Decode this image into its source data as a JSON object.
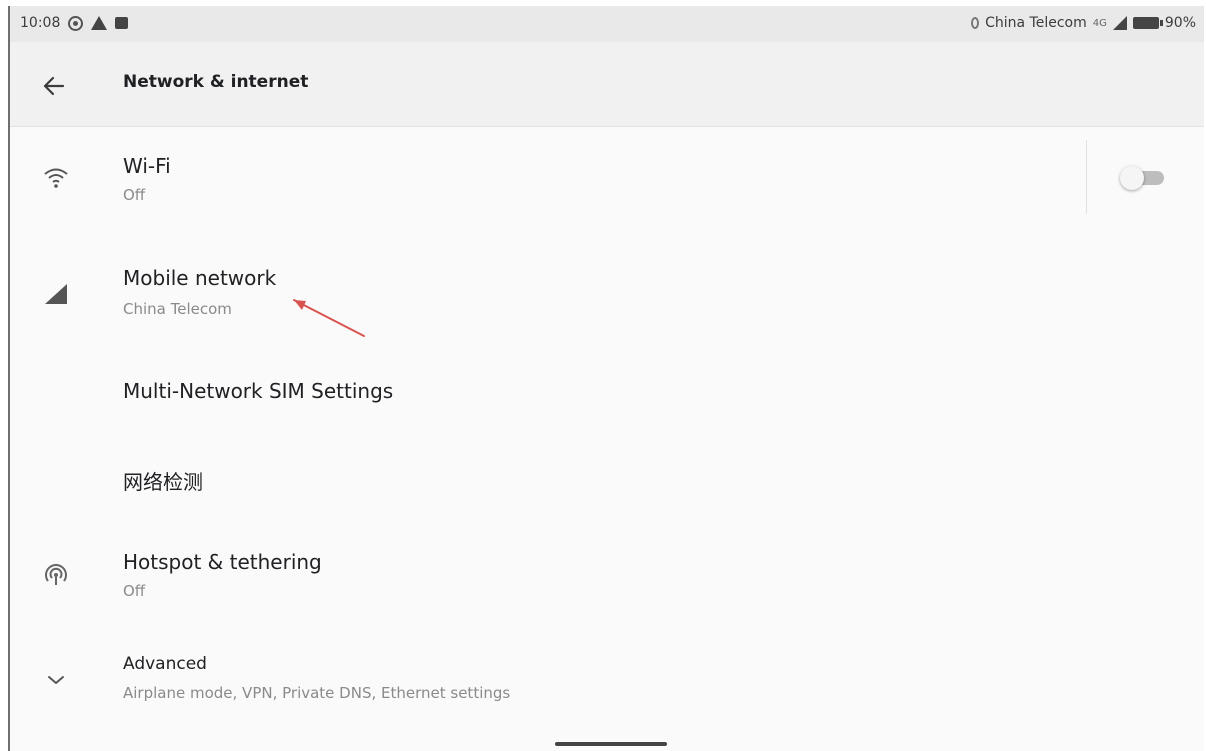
{
  "status_bar": {
    "time": "10:08",
    "carrier": "China Telecom",
    "network_type": "4G",
    "battery": "90%"
  },
  "app_bar": {
    "title": "Network & internet"
  },
  "items": [
    {
      "title": "Wi-Fi",
      "subtitle": "Off",
      "icon": "wifi-icon",
      "toggle_on": false
    },
    {
      "title": "Mobile network",
      "subtitle": "China Telecom",
      "icon": "signal-icon"
    },
    {
      "title": "Multi-Network SIM Settings",
      "subtitle": ""
    },
    {
      "title": "网络检测",
      "subtitle": ""
    },
    {
      "title": "Hotspot & tethering",
      "subtitle": "Off",
      "icon": "hotspot-icon"
    },
    {
      "title": "Advanced",
      "subtitle": "Airplane mode, VPN, Private DNS, Ethernet settings",
      "icon": "chevron-down-icon"
    }
  ],
  "colors": {
    "annotation_arrow": "#d9534f",
    "switch_track_off": "#bdbdbd",
    "background": "#fafafa"
  }
}
